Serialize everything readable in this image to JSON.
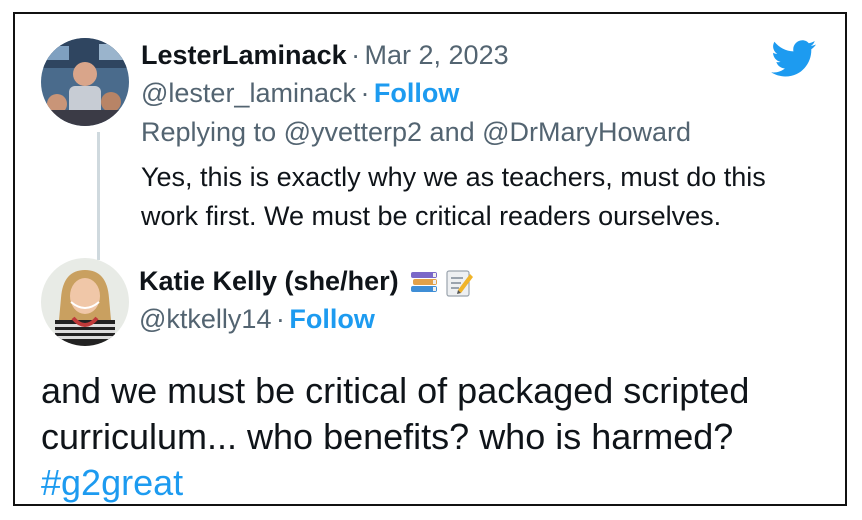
{
  "reply": {
    "display_name": "LesterLaminack",
    "separator": "·",
    "date": "Mar 2, 2023",
    "handle": "@lester_laminack",
    "follow_label": "Follow",
    "replying_to": "Replying to @yvetterp2 and @DrMaryHoward",
    "text_line1": "Yes, this is exactly why we as teachers, must do this",
    "text_line2": "work first. We must be critical readers ourselves."
  },
  "tweet": {
    "display_name": "Katie Kelly (she/her)",
    "handle": "@ktkelly14",
    "separator": "·",
    "follow_label": "Follow",
    "text_line1": "and we must be critical of packaged scripted",
    "text_line2": "curriculum... who benefits? who is harmed?",
    "hashtag": "#g2great"
  },
  "icons": {
    "brand": "twitter-bird-icon",
    "name_emojis": [
      "books-icon",
      "memo-icon"
    ]
  },
  "colors": {
    "link": "#1d9bf0",
    "muted": "#536471",
    "text": "#0f1419",
    "thread_line": "#cfd9de"
  }
}
